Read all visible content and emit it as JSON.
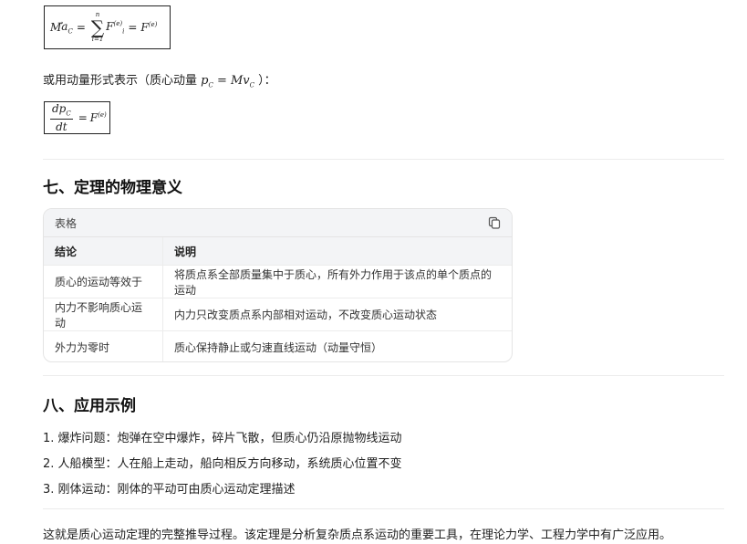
{
  "eq1": {
    "lhs_mass": "M",
    "lhs_accel": "a",
    "lhs_accel_sub": "C",
    "equals": "=",
    "sum_top": "n",
    "sum_bottom": "i=1",
    "term_f": "F",
    "term_f_sub": "i",
    "term_f_sup": "(e)",
    "equals2": "=",
    "rhs_f": "F",
    "rhs_f_sup": "(e)"
  },
  "momentum_intro": {
    "text_before": "或用动量形式表示（质心动量 ",
    "formula": "p",
    "formula_sub": "C",
    "formula_rest": " = Mv",
    "formula_rest_sub": "C",
    "text_after": " ）："
  },
  "eq2": {
    "num": "dp",
    "num_sub": "C",
    "den": "dt",
    "equals": "=",
    "rhs": "F",
    "rhs_sup": "(e)"
  },
  "section7": {
    "title": "七、定理的物理意义"
  },
  "table": {
    "label": "表格",
    "headers": [
      "结论",
      "说明"
    ],
    "rows": [
      [
        "质心的运动等效于",
        "将质点系全部质量集中于质心，所有外力作用于该点的单个质点的运动"
      ],
      [
        "内力不影响质心运动",
        "内力只改变质点系内部相对运动，不改变质心运动状态"
      ],
      [
        "外力为零时",
        "质心保持静止或匀速直线运动（动量守恒）"
      ]
    ]
  },
  "section8": {
    "title": "八、应用示例"
  },
  "examples": [
    "1. 爆炸问题：炮弹在空中爆炸，碎片飞散，但质心仍沿原抛物线运动",
    "2. 人船模型：人在船上走动，船向相反方向移动，系统质心位置不变",
    "3. 刚体运动：刚体的平动可由质心运动定理描述"
  ],
  "conclusion": "这就是质心运动定理的完整推导过程。该定理是分析复杂质点系运动的重要工具，在理论力学、工程力学中有广泛应用。"
}
